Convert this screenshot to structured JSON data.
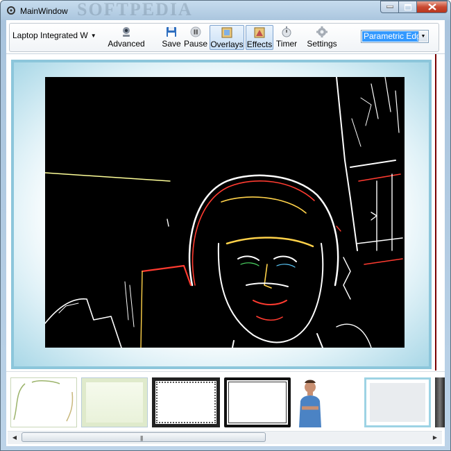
{
  "window": {
    "title": "MainWindow",
    "watermark": "SOFTPEDIA"
  },
  "toolbar": {
    "camera_selector": "Laptop Integrated W",
    "buttons": [
      {
        "id": "advanced",
        "label": "Advanced",
        "icon": "webcam-icon"
      },
      {
        "id": "save",
        "label": "Save",
        "icon": "floppy-disk-icon"
      },
      {
        "id": "pause",
        "label": "Pause",
        "icon": "pause-icon"
      },
      {
        "id": "overlays",
        "label": "Overlays",
        "icon": "overlays-icon",
        "checked": true
      },
      {
        "id": "effects",
        "label": "Effects",
        "icon": "effects-icon",
        "checked": true
      },
      {
        "id": "timer",
        "label": "Timer",
        "icon": "stopwatch-icon"
      },
      {
        "id": "settings",
        "label": "Settings",
        "icon": "gear-icon"
      }
    ],
    "effect_selected": "Parametric Edge"
  },
  "gallery": {
    "items": [
      {
        "name": "overlay-vine-frame"
      },
      {
        "name": "overlay-floral-frame"
      },
      {
        "name": "overlay-grunge-frame"
      },
      {
        "name": "overlay-brush-frame"
      },
      {
        "name": "overlay-man-cutout"
      },
      {
        "name": "overlay-soft-blue-frame"
      },
      {
        "name": "overlay-dark-frame"
      }
    ]
  },
  "colors": {
    "frame_blue": "#a6d6e6",
    "selection_blue": "#3399ff",
    "close_red": "#c94a32"
  }
}
